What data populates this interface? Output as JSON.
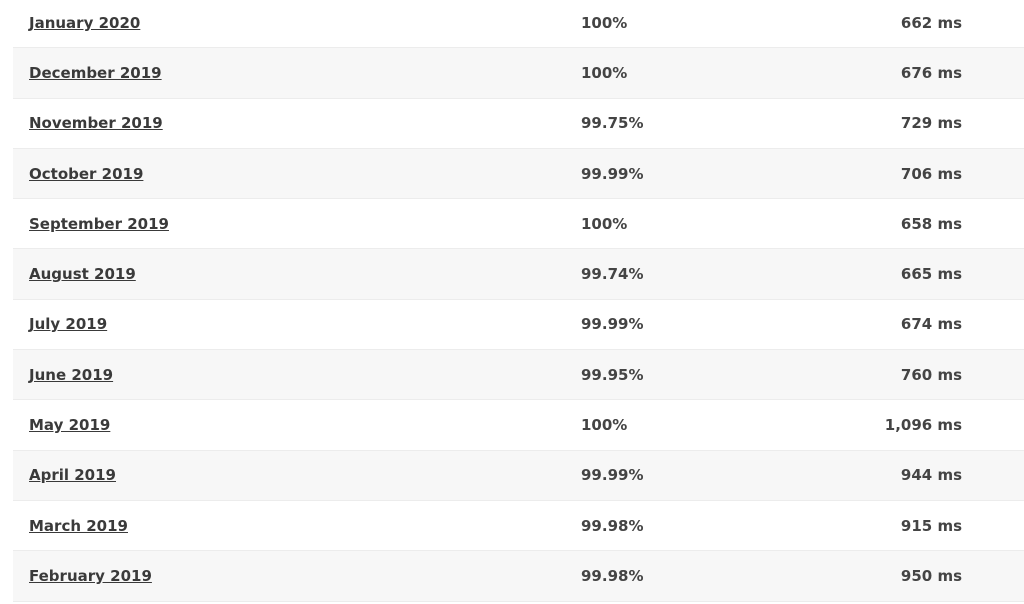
{
  "rows": [
    {
      "month": "January 2020",
      "uptime": "100%",
      "response": "662 ms"
    },
    {
      "month": "December 2019",
      "uptime": "100%",
      "response": "676 ms"
    },
    {
      "month": "November 2019",
      "uptime": "99.75%",
      "response": "729 ms"
    },
    {
      "month": "October 2019",
      "uptime": "99.99%",
      "response": "706 ms"
    },
    {
      "month": "September 2019",
      "uptime": "100%",
      "response": "658 ms"
    },
    {
      "month": "August 2019",
      "uptime": "99.74%",
      "response": "665 ms"
    },
    {
      "month": "July 2019",
      "uptime": "99.99%",
      "response": "674 ms"
    },
    {
      "month": "June 2019",
      "uptime": "99.95%",
      "response": "760 ms"
    },
    {
      "month": "May 2019",
      "uptime": "100%",
      "response": "1,096 ms"
    },
    {
      "month": "April 2019",
      "uptime": "99.99%",
      "response": "944 ms"
    },
    {
      "month": "March 2019",
      "uptime": "99.98%",
      "response": "915 ms"
    },
    {
      "month": "February 2019",
      "uptime": "99.98%",
      "response": "950 ms"
    }
  ]
}
